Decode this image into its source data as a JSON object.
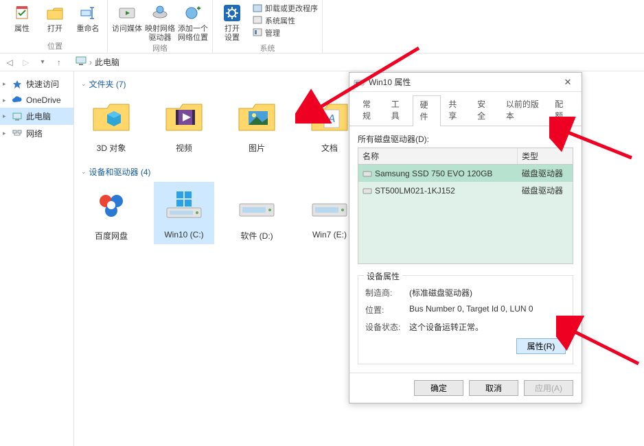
{
  "ribbon": {
    "groups": [
      {
        "label": "位置",
        "items": [
          {
            "label": "属性",
            "icon": "properties"
          },
          {
            "label": "打开",
            "icon": "open"
          },
          {
            "label": "重命名",
            "icon": "rename"
          }
        ]
      },
      {
        "label": "网络",
        "items": [
          {
            "label": "访问媒体",
            "icon": "media"
          },
          {
            "label": "映射网络\n驱动器",
            "icon": "mapdrive"
          },
          {
            "label": "添加一个\n网络位置",
            "icon": "addnet"
          }
        ]
      },
      {
        "label": "系统",
        "items": [
          {
            "label": "打开\n设置",
            "icon": "settings"
          }
        ],
        "mini": [
          {
            "label": "卸载或更改程序",
            "icon": "uninstall"
          },
          {
            "label": "系统属性",
            "icon": "sysprops"
          },
          {
            "label": "管理",
            "icon": "manage"
          }
        ]
      }
    ]
  },
  "breadcrumb": {
    "root_icon": "pc",
    "root": "此电脑"
  },
  "sidebar": [
    {
      "label": "快速访问",
      "icon": "star",
      "chevron": true
    },
    {
      "label": "OneDrive",
      "icon": "cloud",
      "chevron": true
    },
    {
      "label": "此电脑",
      "icon": "pc",
      "chevron": true,
      "selected": true
    },
    {
      "label": "网络",
      "icon": "network",
      "chevron": true
    }
  ],
  "sections": [
    {
      "title": "文件夹 (7)",
      "items": [
        {
          "label": "3D 对象",
          "icon": "folder-3d"
        },
        {
          "label": "视频",
          "icon": "folder-video"
        },
        {
          "label": "图片",
          "icon": "folder-pic"
        },
        {
          "label": "文档",
          "icon": "folder-doc"
        }
      ]
    },
    {
      "title": "设备和驱动器 (4)",
      "items": [
        {
          "label": "百度网盘",
          "icon": "baidu"
        },
        {
          "label": "Win10 (C:)",
          "icon": "drive-win",
          "selected": true
        },
        {
          "label": "软件 (D:)",
          "icon": "drive"
        },
        {
          "label": "Win7 (E:)",
          "icon": "drive"
        }
      ]
    }
  ],
  "dialog": {
    "title": "Win10      属性",
    "tabs": [
      "常规",
      "工具",
      "硬件",
      "共享",
      "安全",
      "以前的版本",
      "配额"
    ],
    "active_tab": 2,
    "drives_label": "所有磁盘驱动器(D):",
    "columns": {
      "name": "名称",
      "type": "类型"
    },
    "rows": [
      {
        "name": "Samsung SSD 750 EVO 120GB",
        "type": "磁盘驱动器",
        "selected": true
      },
      {
        "name": "ST500LM021-1KJ152",
        "type": "磁盘驱动器"
      }
    ],
    "props_title": "设备属性",
    "props": {
      "manufacturer_k": "制造商:",
      "manufacturer_v": "(标准磁盘驱动器)",
      "location_k": "位置:",
      "location_v": "Bus Number 0, Target Id 0, LUN 0",
      "status_k": "设备状态:",
      "status_v": "这个设备运转正常。"
    },
    "properties_btn": "属性(R)",
    "ok": "确定",
    "cancel": "取消",
    "apply": "应用(A)"
  }
}
